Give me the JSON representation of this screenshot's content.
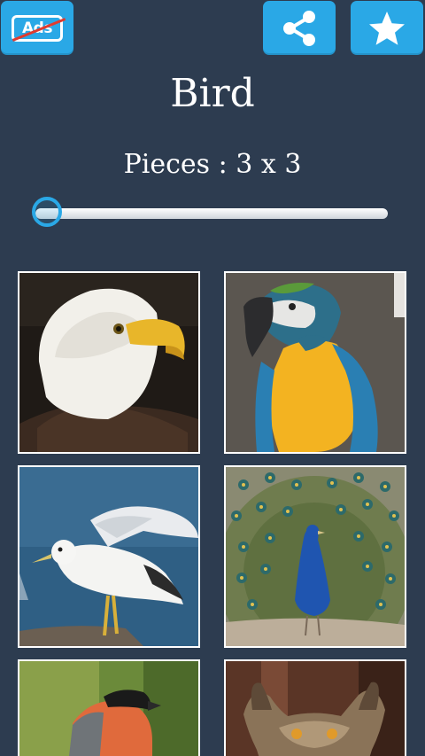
{
  "header": {
    "ads_label": "Ads",
    "buttons": [
      {
        "name": "remove-ads",
        "icon": "ads-crossed-icon"
      },
      {
        "name": "share",
        "icon": "share-icon"
      },
      {
        "name": "favorite",
        "icon": "star-icon"
      }
    ]
  },
  "category": {
    "title": "Bird"
  },
  "pieces": {
    "label": "Pieces : 3 x 3",
    "slider_level": 0
  },
  "gallery": {
    "images": [
      {
        "subject": "bald eagle"
      },
      {
        "subject": "macaw parrot"
      },
      {
        "subject": "seagull"
      },
      {
        "subject": "peacock"
      },
      {
        "subject": "bullfinch"
      },
      {
        "subject": "owl"
      }
    ]
  },
  "colors": {
    "background": "#2d3c50",
    "accent": "#2aa8e6"
  }
}
